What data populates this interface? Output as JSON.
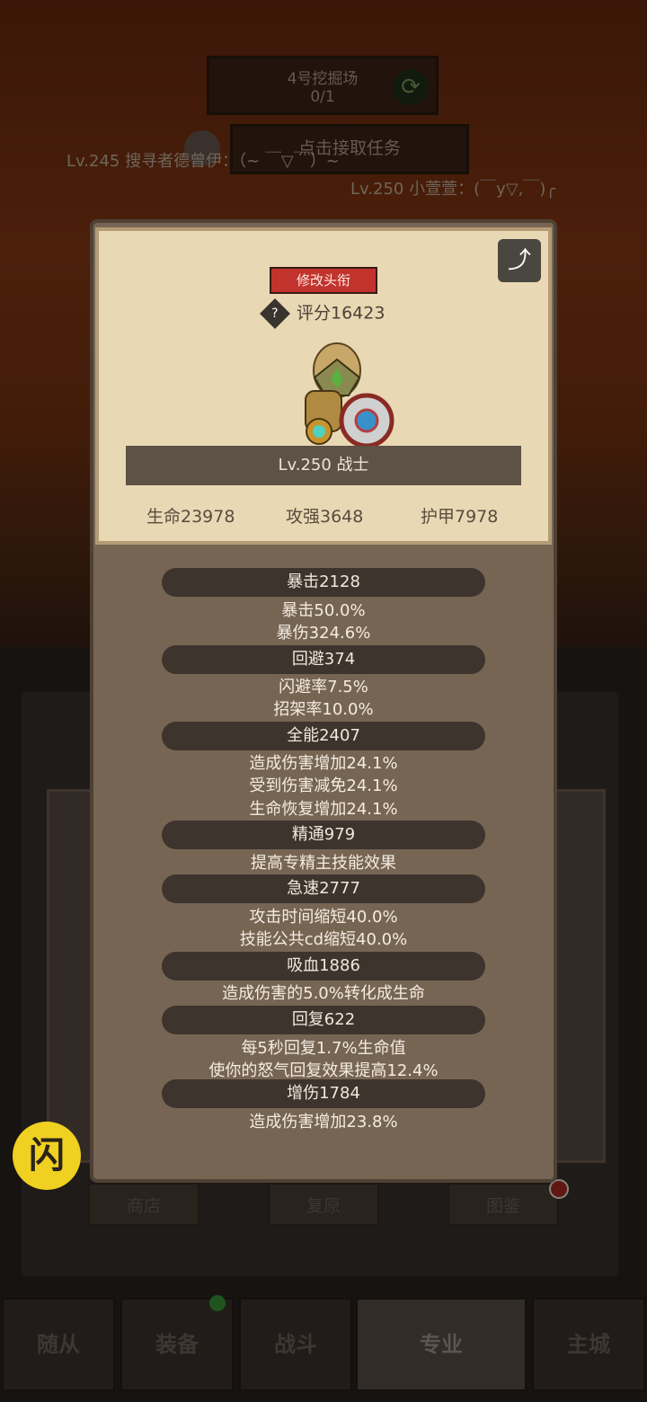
{
  "mission": {
    "name": "4号挖掘场",
    "progress": "0/1",
    "refresh_icon": "refresh-icon"
  },
  "task": {
    "label": "点击接取任务"
  },
  "chat": [
    "Lv.245 搜寻者德曾伊：（~ ￣▽￣）~",
    "Lv.250 小萱萱：(￣y▽,￣)╭"
  ],
  "card": {
    "title_button": "修改头衔",
    "rating": "评分16423",
    "level_class": "Lv.250 战士",
    "hp": "生命23978",
    "attack": "攻强3648",
    "armor": "护甲7978"
  },
  "stats": {
    "crit": {
      "header": "暴击2128",
      "lines": [
        "暴击50.0%",
        "暴伤324.6%"
      ]
    },
    "dodge": {
      "header": "回避374",
      "lines": [
        "闪避率7.5%",
        "招架率10.0%"
      ]
    },
    "versatility": {
      "header": "全能2407",
      "lines": [
        "造成伤害增加24.1%",
        "受到伤害减免24.1%",
        "生命恢复增加24.1%"
      ]
    },
    "mastery": {
      "header": "精通979",
      "lines": [
        "提高专精主技能效果"
      ]
    },
    "haste": {
      "header": "急速2777",
      "lines": [
        "攻击时间缩短40.0%",
        "技能公共cd缩短40.0%"
      ]
    },
    "leech": {
      "header": "吸血1886",
      "lines": [
        "造成伤害的5.0%转化成生命"
      ]
    },
    "regen": {
      "header": "回复622",
      "lines": [
        "每5秒回复1.7%生命值",
        "使你的怒气回复效果提高12.4%"
      ]
    },
    "dmg_bonus": {
      "header": "增伤1784",
      "lines": [
        "造成伤害增加23.8%"
      ]
    }
  },
  "under_buttons": [
    "商店",
    "复原",
    "图鉴"
  ],
  "flash_button": "闪",
  "bottom_nav": [
    "随从",
    "装备",
    "战斗",
    "专业",
    "主城"
  ],
  "colors": {
    "title_button": "#c2332e",
    "modal": "#776554",
    "card": "#e8d8b4",
    "flash": "#f0d020"
  }
}
